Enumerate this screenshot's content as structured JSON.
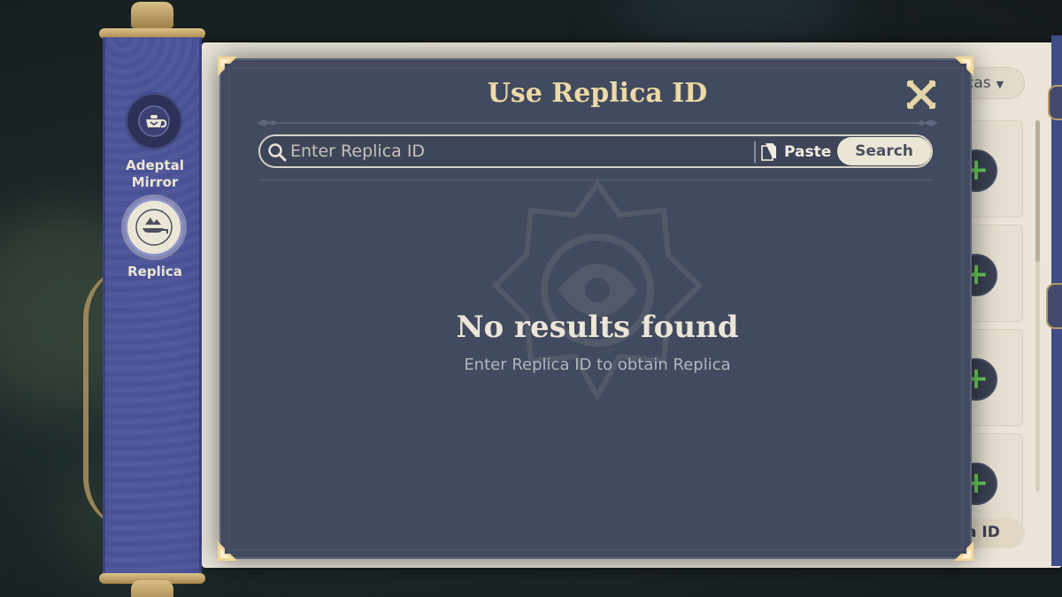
{
  "background_panel": {
    "dropdown_label": "cas",
    "id_button_label": "a ID",
    "accent_green": "#68d15c"
  },
  "sidebar": {
    "items": [
      {
        "label_line1": "Adeptal",
        "label_line2": "Mirror",
        "icon": "teapot-icon",
        "active": false
      },
      {
        "label": "Replica",
        "icon": "replica-boat-icon",
        "active": true
      }
    ]
  },
  "dialog": {
    "title": "Use Replica ID",
    "search": {
      "placeholder": "Enter Replica ID",
      "value": "",
      "paste_label": "Paste",
      "search_label": "Search"
    },
    "empty_state": {
      "title": "No results found",
      "subtitle": "Enter Replica ID to obtain Replica"
    }
  },
  "colors": {
    "dialog_bg": "#414a5e",
    "title_gold": "#ecd9a5",
    "sidebar_blue": "#4a5297",
    "panel_cream": "#ece6da"
  }
}
